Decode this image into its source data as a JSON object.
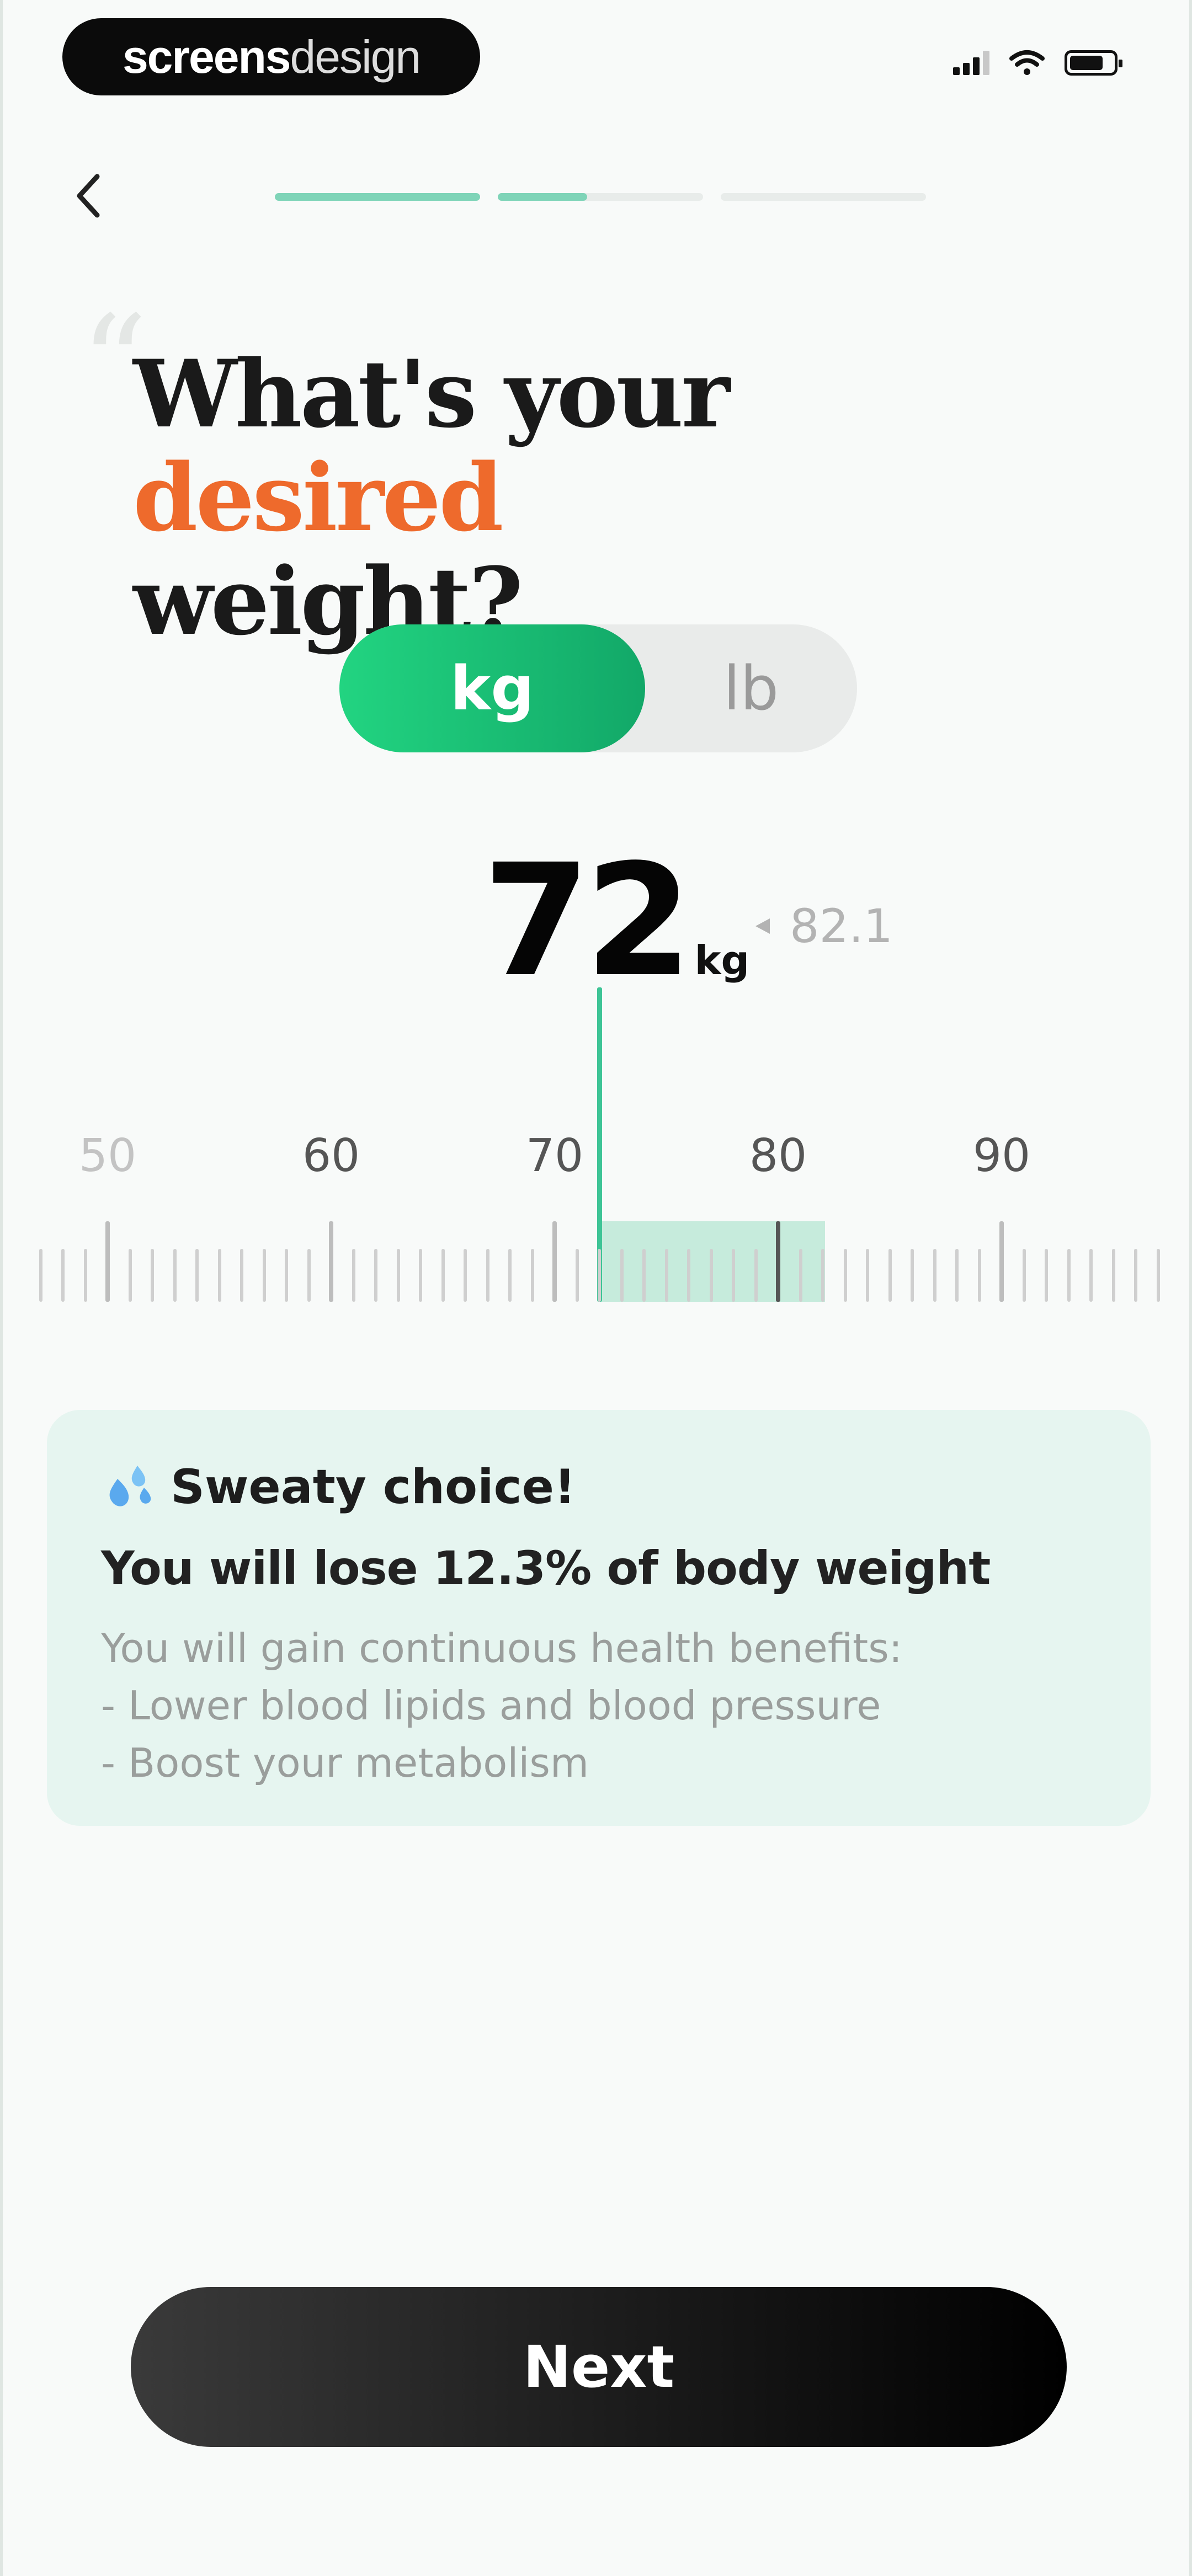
{
  "status_bar": {
    "brand_part1": "screens",
    "brand_part2": "design",
    "signal_icon": "cellular-signal-icon",
    "wifi_icon": "wifi-icon",
    "battery_icon": "battery-icon"
  },
  "nav": {
    "back_icon": "chevron-left-icon",
    "progress_fraction": 0.4
  },
  "question": {
    "title_part1": "What's your ",
    "title_accent": "desired",
    "title_part2": "weight?"
  },
  "unit_toggle": {
    "options": [
      "kg",
      "lb"
    ],
    "selected": "kg"
  },
  "weight": {
    "value": "72",
    "unit": "kg",
    "current_value": "82.1"
  },
  "ruler": {
    "labels": [
      "50",
      "60",
      "70",
      "80",
      "90"
    ],
    "min": 47,
    "max": 97,
    "selected_value": 72,
    "current_value": 82.1
  },
  "info_card": {
    "icon": "sweat-droplets-icon",
    "title": "Sweaty choice!",
    "subtitle": "You will lose 12.3% of body weight",
    "body_line1": "You will gain continuous health benefits:",
    "body_line2": "- Lower blood lipids and blood pressure",
    "body_line3": "- Boost your metabolism"
  },
  "footer": {
    "next_label": "Next"
  },
  "colors": {
    "accent": "#ee6a2c",
    "primary_green": "#1fc77c",
    "indicator": "#3ec496",
    "card_bg": "#e6f5f0"
  }
}
